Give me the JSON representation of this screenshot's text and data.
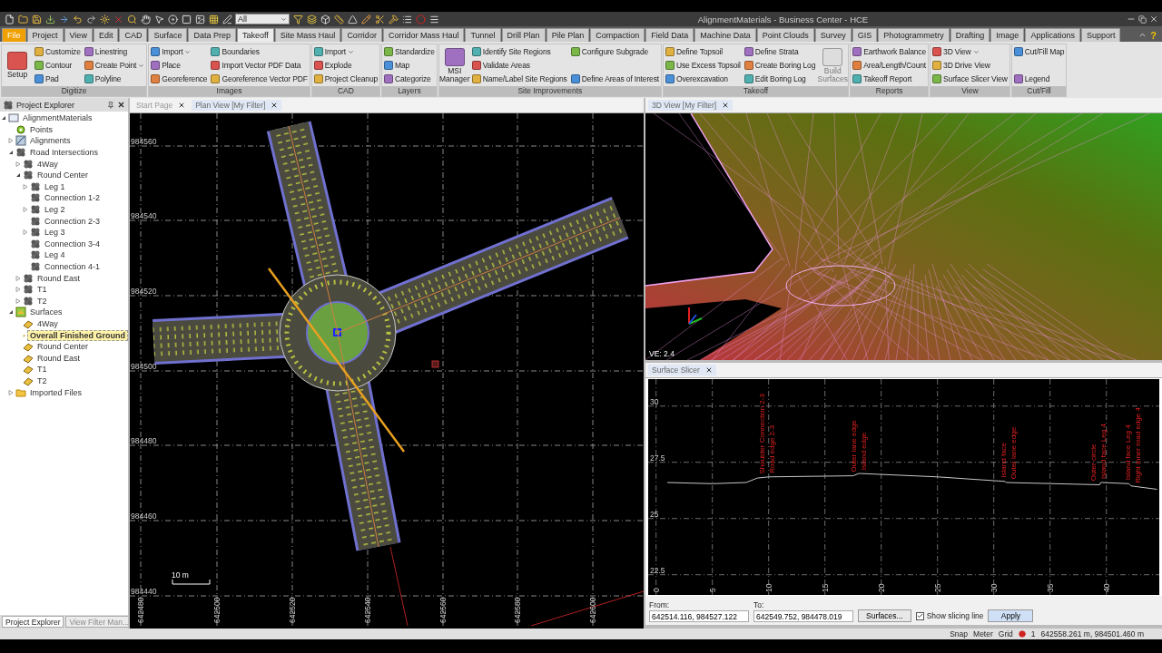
{
  "window": {
    "title": "AlignmentMaterials - Business Center - HCE",
    "filter_combo": "All",
    "help_glyph": "?"
  },
  "ribbon_tabs": [
    {
      "label": "File",
      "kind": "file",
      "selected": false
    },
    {
      "label": "Project",
      "kind": "tab",
      "selected": false
    },
    {
      "label": "View",
      "kind": "tab",
      "selected": false
    },
    {
      "label": "Edit",
      "kind": "tab",
      "selected": false
    },
    {
      "label": "CAD",
      "kind": "tab",
      "selected": false
    },
    {
      "label": "Surface",
      "kind": "tab",
      "selected": false
    },
    {
      "label": "Data Prep",
      "kind": "tab",
      "selected": false
    },
    {
      "label": "Takeoff",
      "kind": "tab",
      "selected": true
    },
    {
      "label": "Site Mass Haul",
      "kind": "tab",
      "selected": false
    },
    {
      "label": "Corridor",
      "kind": "tab",
      "selected": false
    },
    {
      "label": "Corridor Mass Haul",
      "kind": "tab",
      "selected": false
    },
    {
      "label": "Tunnel",
      "kind": "tab",
      "selected": false
    },
    {
      "label": "Drill Plan",
      "kind": "tab",
      "selected": false
    },
    {
      "label": "Pile Plan",
      "kind": "tab",
      "selected": false
    },
    {
      "label": "Compaction",
      "kind": "tab",
      "selected": false
    },
    {
      "label": "Field Data",
      "kind": "tab",
      "selected": false
    },
    {
      "label": "Machine Data",
      "kind": "tab",
      "selected": false
    },
    {
      "label": "Point Clouds",
      "kind": "tab",
      "selected": false
    },
    {
      "label": "Survey",
      "kind": "tab",
      "selected": false
    },
    {
      "label": "GIS",
      "kind": "tab",
      "selected": false
    },
    {
      "label": "Photogrammetry",
      "kind": "tab",
      "selected": false
    },
    {
      "label": "Drafting",
      "kind": "tab",
      "selected": false
    },
    {
      "label": "Image",
      "kind": "tab",
      "selected": false
    },
    {
      "label": "Applications",
      "kind": "tab",
      "selected": false
    },
    {
      "label": "Support",
      "kind": "tab",
      "selected": false
    }
  ],
  "ribbon_groups": [
    {
      "label": "Digitize",
      "items": [
        {
          "label": "Setup",
          "kind": "large"
        },
        {
          "label": "Customize",
          "kind": "small"
        },
        {
          "label": "Contour",
          "kind": "small"
        },
        {
          "label": "Pad",
          "kind": "small"
        },
        {
          "label": "Linestring",
          "kind": "small"
        },
        {
          "label": "Create Point",
          "kind": "small",
          "dropdown": true
        },
        {
          "label": "Polyline",
          "kind": "small"
        }
      ]
    },
    {
      "label": "Images",
      "items": [
        {
          "label": "Import",
          "kind": "small",
          "dropdown": true
        },
        {
          "label": "Place",
          "kind": "small"
        },
        {
          "label": "Georeference",
          "kind": "small"
        },
        {
          "label": "Boundaries",
          "kind": "small"
        },
        {
          "label": "Import Vector PDF Data",
          "kind": "small"
        },
        {
          "label": "Georeference Vector PDF",
          "kind": "small"
        }
      ]
    },
    {
      "label": "CAD",
      "items": [
        {
          "label": "Import",
          "kind": "small",
          "dropdown": true
        },
        {
          "label": "Explode",
          "kind": "small"
        },
        {
          "label": "Project Cleanup",
          "kind": "small"
        }
      ]
    },
    {
      "label": "Layers",
      "items": [
        {
          "label": "Standardize",
          "kind": "small"
        },
        {
          "label": "Map",
          "kind": "small"
        },
        {
          "label": "Categorize",
          "kind": "small"
        }
      ]
    },
    {
      "label": "Site Improvements",
      "items": [
        {
          "label": "MSI Manager",
          "kind": "large"
        },
        {
          "label": "Identify Site Regions",
          "kind": "small"
        },
        {
          "label": "Validate Areas",
          "kind": "small"
        },
        {
          "label": "Name/Label Site Regions",
          "kind": "small"
        },
        {
          "label": "Configure Subgrade",
          "kind": "small"
        },
        {
          "label": "Define Areas of Interest",
          "kind": "small"
        }
      ]
    },
    {
      "label": "Takeoff",
      "items": [
        {
          "label": "Define Topsoil",
          "kind": "small"
        },
        {
          "label": "Use Excess Topsoil",
          "kind": "small"
        },
        {
          "label": "Overexcavation",
          "kind": "small"
        },
        {
          "label": "Define Strata",
          "kind": "small"
        },
        {
          "label": "Create Boring Log",
          "kind": "small"
        },
        {
          "label": "Edit Boring Log",
          "kind": "small"
        },
        {
          "label": "Build Surfaces",
          "kind": "large",
          "disabled": true
        }
      ]
    },
    {
      "label": "Reports",
      "items": [
        {
          "label": "Earthwork Balance",
          "kind": "small"
        },
        {
          "label": "Area/Length/Count",
          "kind": "small"
        },
        {
          "label": "Takeoff Report",
          "kind": "small"
        }
      ]
    },
    {
      "label": "View",
      "items": [
        {
          "label": "3D View",
          "kind": "small",
          "dropdown": true
        },
        {
          "label": "3D Drive View",
          "kind": "small"
        },
        {
          "label": "Surface Slicer View",
          "kind": "small"
        }
      ]
    },
    {
      "label": "Cut/Fill",
      "items": [
        {
          "label": "Cut/Fill Map",
          "kind": "small"
        },
        {
          "label": "Legend",
          "kind": "small"
        }
      ]
    }
  ],
  "project_explorer": {
    "title": "Project Explorer",
    "tree": [
      {
        "label": "AlignmentMaterials",
        "kind": "project",
        "expanded": true,
        "selected": false,
        "children": [
          {
            "label": "Points",
            "kind": "points",
            "selected": false
          },
          {
            "label": "Alignments",
            "kind": "alignments",
            "expanded": false,
            "selected": false
          },
          {
            "label": "Road Intersections",
            "kind": "intersection",
            "expanded": true,
            "selected": false,
            "children": [
              {
                "label": "4Way",
                "kind": "intersection",
                "expanded": false,
                "selected": false
              },
              {
                "label": "Round Center",
                "kind": "intersection",
                "expanded": true,
                "selected": false,
                "children": [
                  {
                    "label": "Leg 1",
                    "kind": "intersection",
                    "expanded": false,
                    "selected": false
                  },
                  {
                    "label": "Connection 1-2",
                    "kind": "intersection",
                    "selected": false
                  },
                  {
                    "label": "Leg 2",
                    "kind": "intersection",
                    "expanded": false,
                    "selected": false
                  },
                  {
                    "label": "Connection 2-3",
                    "kind": "intersection",
                    "selected": false
                  },
                  {
                    "label": "Leg 3",
                    "kind": "intersection",
                    "expanded": false,
                    "selected": false
                  },
                  {
                    "label": "Connection 3-4",
                    "kind": "intersection",
                    "selected": false
                  },
                  {
                    "label": "Leg 4",
                    "kind": "intersection",
                    "selected": false
                  },
                  {
                    "label": "Connection 4-1",
                    "kind": "intersection",
                    "selected": false
                  }
                ]
              },
              {
                "label": "Round East",
                "kind": "intersection",
                "expanded": false,
                "selected": false
              },
              {
                "label": "T1",
                "kind": "intersection",
                "expanded": false,
                "selected": false
              },
              {
                "label": "T2",
                "kind": "intersection",
                "expanded": false,
                "selected": false
              }
            ]
          },
          {
            "label": "Surfaces",
            "kind": "surfaces",
            "expanded": true,
            "selected": false,
            "children": [
              {
                "label": "4Way",
                "kind": "surface",
                "selected": false
              },
              {
                "label": "Overall Finished Ground",
                "kind": "surface",
                "selected": true
              },
              {
                "label": "Round Center",
                "kind": "surface",
                "selected": false
              },
              {
                "label": "Round East",
                "kind": "surface",
                "selected": false
              },
              {
                "label": "T1",
                "kind": "surface",
                "selected": false
              },
              {
                "label": "T2",
                "kind": "surface",
                "selected": false
              }
            ]
          },
          {
            "label": "Imported Files",
            "kind": "folder",
            "expanded": false,
            "selected": false
          }
        ]
      }
    ],
    "bottom_tabs": [
      {
        "label": "Project Explorer",
        "selected": true
      },
      {
        "label": "View Filter Man...",
        "selected": false
      }
    ]
  },
  "plan_view": {
    "tabs": [
      {
        "label": "Start Page",
        "selected": false
      },
      {
        "label": "Plan View [My Filter]",
        "selected": true
      }
    ],
    "northing_labels": [
      "984560",
      "984540",
      "984520",
      "984500",
      "984480",
      "984460",
      "984440"
    ],
    "easting_labels": [
      "642480",
      "642500",
      "642520",
      "642540",
      "642560",
      "642580",
      "642600"
    ],
    "scale_label": "10 m"
  },
  "view_3d": {
    "tabs": [
      {
        "label": "3D View [My Filter]",
        "selected": true
      }
    ],
    "exaggeration_label": "VE: 2.4"
  },
  "surface_slicer": {
    "tabs": [
      {
        "label": "Surface Slicer",
        "selected": true
      }
    ],
    "chart_data": {
      "type": "line",
      "grid": true,
      "x": [
        1,
        5,
        8,
        9,
        10,
        17.5,
        18,
        18.2,
        25,
        31,
        31.1,
        39.4,
        39.5,
        39.6,
        42,
        42.2,
        44.5
      ],
      "series": [
        {
          "color": "#c8c8c8",
          "values": [
            26.6,
            26.55,
            26.6,
            26.8,
            26.85,
            26.9,
            27.0,
            27.0,
            26.85,
            26.65,
            26.6,
            26.5,
            26.6,
            26.6,
            26.55,
            26.45,
            26.3
          ]
        }
      ],
      "xlim": [
        -0.7,
        44.7
      ],
      "ylim": [
        21.6,
        31.2
      ],
      "xticks": [
        0,
        5,
        10,
        15,
        20,
        25,
        30,
        35,
        40
      ],
      "yticks": [
        22.5,
        25,
        27.5,
        30
      ],
      "annotations": [
        "Shoulder Connection 2-3",
        "Road edge 2-3",
        "Outer lane edge",
        "Island edge",
        "Island face",
        "Outer lane edge",
        "Outer circle",
        "Island face Leg 4",
        "Island face Leg 4",
        "Right inner road edge 4"
      ]
    },
    "from_label": "From:",
    "from_value": "642514.116, 984527.122",
    "to_label": "To:",
    "to_value": "642549.752, 984478.019",
    "surfaces_button": "Surfaces...",
    "show_slicing_line": {
      "label": "Show slicing line",
      "checked": true
    },
    "apply_button": "Apply"
  },
  "status_bar": {
    "items": [
      "Snap",
      "Meter",
      "Grid"
    ],
    "count": "1",
    "coordinates": "642558.261 m, 984501.460 m"
  }
}
